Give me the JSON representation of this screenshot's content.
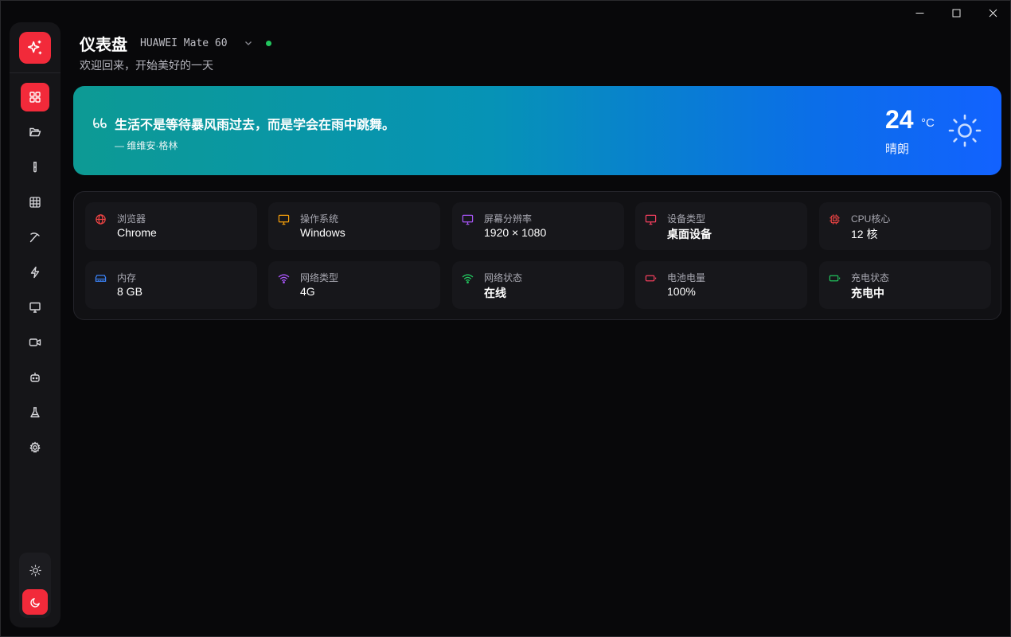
{
  "window": {
    "minimize_icon": "minimize-icon",
    "maximize_icon": "maximize-icon",
    "close_icon": "close-icon"
  },
  "sidebar": {
    "logo_icon": "sparkles-icon",
    "accent_color": "#f22a3a",
    "items": [
      {
        "icon": "dashboard-icon",
        "active": true
      },
      {
        "icon": "folder-open-icon",
        "active": false
      },
      {
        "icon": "test-tube-icon",
        "active": false
      },
      {
        "icon": "grid-icon",
        "active": false
      },
      {
        "icon": "pickaxe-icon",
        "active": false
      },
      {
        "icon": "lightning-icon",
        "active": false
      },
      {
        "icon": "monitor-icon",
        "active": false
      },
      {
        "icon": "video-icon",
        "active": false
      },
      {
        "icon": "robot-icon",
        "active": false
      },
      {
        "icon": "flask-icon",
        "active": false
      },
      {
        "icon": "settings-icon",
        "active": false
      }
    ],
    "theme": {
      "light_icon": "sun-icon",
      "dark_icon": "moon-icon",
      "active": "dark"
    }
  },
  "header": {
    "title": "仪表盘",
    "device": "HUAWEI Mate 60",
    "status_color": "#22c55e",
    "subtitle": "欢迎回来，开始美好的一天"
  },
  "banner": {
    "quote": "生活不是等待暴风雨过去，而是学会在雨中跳舞。",
    "author": "— 维维安·格林",
    "temperature": "24",
    "unit": "°C",
    "condition": "晴朗",
    "weather_icon": "sun-icon"
  },
  "info_cards": [
    {
      "label": "浏览器",
      "value": "Chrome",
      "icon": "globe-icon",
      "color": "#ef4444"
    },
    {
      "label": "操作系统",
      "value": "Windows",
      "icon": "monitor-icon",
      "color": "#f59e0b"
    },
    {
      "label": "屏幕分辨率",
      "value": "1920 × 1080",
      "icon": "monitor-icon",
      "color": "#a855f7"
    },
    {
      "label": "设备类型",
      "value": "桌面设备",
      "icon": "monitor-icon",
      "color": "#f43f5e"
    },
    {
      "label": "CPU核心",
      "value": "12 核",
      "icon": "cpu-icon",
      "color": "#ef4444"
    },
    {
      "label": "内存",
      "value": "8 GB",
      "icon": "memory-icon",
      "color": "#3b82f6"
    },
    {
      "label": "网络类型",
      "value": "4G",
      "icon": "wifi-icon",
      "color": "#a855f7"
    },
    {
      "label": "网络状态",
      "value": "在线",
      "icon": "wifi-icon",
      "color": "#22c55e"
    },
    {
      "label": "电池电量",
      "value": "100%",
      "icon": "battery-icon",
      "color": "#f43f5e"
    },
    {
      "label": "充电状态",
      "value": "充电中",
      "icon": "battery-charging-icon",
      "color": "#22c55e"
    }
  ]
}
